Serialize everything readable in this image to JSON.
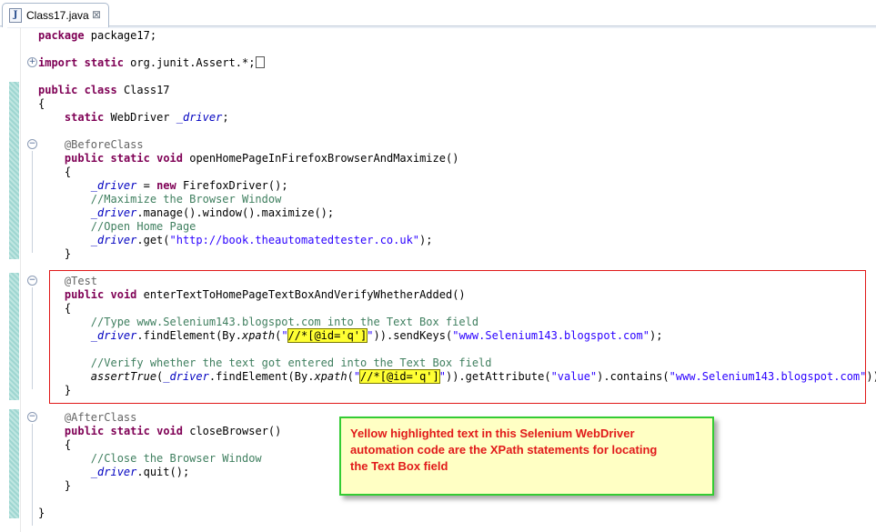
{
  "tab": {
    "icon": "java-file-icon",
    "title": "Class17.java",
    "close": "⊠"
  },
  "fold_markers": {
    "expand": "+",
    "collapse": "−"
  },
  "code": [
    [
      [
        "kw",
        "package"
      ],
      [
        "t",
        " package17;"
      ]
    ],
    [],
    [
      [
        "kw",
        "import"
      ],
      [
        "t",
        " "
      ],
      [
        "kw",
        "static"
      ],
      [
        "t",
        " org.junit.Assert.*;"
      ],
      [
        "box",
        ""
      ]
    ],
    [],
    [
      [
        "kw",
        "public"
      ],
      [
        "t",
        " "
      ],
      [
        "kw",
        "class"
      ],
      [
        "t",
        " Class17"
      ]
    ],
    [
      [
        "t",
        "{"
      ]
    ],
    [
      [
        "t",
        "    "
      ],
      [
        "kw",
        "static"
      ],
      [
        "t",
        " WebDriver "
      ],
      [
        "fld",
        "_driver"
      ],
      [
        "t",
        ";"
      ]
    ],
    [],
    [
      [
        "t",
        "    "
      ],
      [
        "ann",
        "@BeforeClass"
      ]
    ],
    [
      [
        "t",
        "    "
      ],
      [
        "kw",
        "public"
      ],
      [
        "t",
        " "
      ],
      [
        "kw",
        "static"
      ],
      [
        "t",
        " "
      ],
      [
        "kw",
        "void"
      ],
      [
        "t",
        " openHomePageInFirefoxBrowserAndMaximize()"
      ]
    ],
    [
      [
        "t",
        "    {"
      ]
    ],
    [
      [
        "t",
        "        "
      ],
      [
        "fld",
        "_driver"
      ],
      [
        "t",
        " = "
      ],
      [
        "kw",
        "new"
      ],
      [
        "t",
        " FirefoxDriver();"
      ]
    ],
    [
      [
        "t",
        "        "
      ],
      [
        "cmt",
        "//Maximize the Browser Window"
      ]
    ],
    [
      [
        "t",
        "        "
      ],
      [
        "fld",
        "_driver"
      ],
      [
        "t",
        ".manage().window().maximize();"
      ]
    ],
    [
      [
        "t",
        "        "
      ],
      [
        "cmt",
        "//Open Home Page"
      ]
    ],
    [
      [
        "t",
        "        "
      ],
      [
        "fld",
        "_driver"
      ],
      [
        "t",
        ".get("
      ],
      [
        "str",
        "\"http://book.theautomatedtester.co.uk\""
      ],
      [
        "t",
        ");"
      ]
    ],
    [
      [
        "t",
        "    }"
      ]
    ],
    [],
    [
      [
        "t",
        "    "
      ],
      [
        "ann",
        "@Test"
      ]
    ],
    [
      [
        "t",
        "    "
      ],
      [
        "kw",
        "public"
      ],
      [
        "t",
        " "
      ],
      [
        "kw",
        "void"
      ],
      [
        "t",
        " enterTextToHomePageTextBoxAndVerifyWhetherAdded()"
      ]
    ],
    [
      [
        "t",
        "    {"
      ]
    ],
    [
      [
        "t",
        "        "
      ],
      [
        "cmt",
        "//Type www.Selenium143.blogspot.com into the Text Box field"
      ]
    ],
    [
      [
        "t",
        "        "
      ],
      [
        "fld",
        "_driver"
      ],
      [
        "t",
        ".findElement(By."
      ],
      [
        "it",
        "xpath"
      ],
      [
        "t",
        "("
      ],
      [
        "str",
        "\""
      ],
      [
        "hl",
        "//*[@id='q']"
      ],
      [
        "str",
        "\""
      ],
      [
        "t",
        "))."
      ],
      [
        "t",
        "sendKeys("
      ],
      [
        "str",
        "\"www.Selenium143.blogspot.com\""
      ],
      [
        "t",
        ");"
      ]
    ],
    [],
    [
      [
        "t",
        "        "
      ],
      [
        "cmt",
        "//Verify whether the text got entered into the Text Box field"
      ]
    ],
    [
      [
        "t",
        "        "
      ],
      [
        "it",
        "assertTrue"
      ],
      [
        "t",
        "("
      ],
      [
        "fld",
        "_driver"
      ],
      [
        "t",
        ".findElement(By."
      ],
      [
        "it",
        "xpath"
      ],
      [
        "t",
        "("
      ],
      [
        "str",
        "\""
      ],
      [
        "hl",
        "//*[@id='q']"
      ],
      [
        "str",
        "\""
      ],
      [
        "t",
        ")).getAttribute("
      ],
      [
        "str",
        "\"value\""
      ],
      [
        "t",
        ").contains("
      ],
      [
        "str",
        "\"www.Selenium143.blogspot.com\""
      ],
      [
        "t",
        "));"
      ]
    ],
    [
      [
        "t",
        "    }"
      ]
    ],
    [],
    [
      [
        "t",
        "    "
      ],
      [
        "ann",
        "@AfterClass"
      ]
    ],
    [
      [
        "t",
        "    "
      ],
      [
        "kw",
        "public"
      ],
      [
        "t",
        " "
      ],
      [
        "kw",
        "static"
      ],
      [
        "t",
        " "
      ],
      [
        "kw",
        "void"
      ],
      [
        "t",
        " closeBrowser()"
      ]
    ],
    [
      [
        "t",
        "    {"
      ]
    ],
    [
      [
        "t",
        "        "
      ],
      [
        "cmt",
        "//Close the Browser Window"
      ]
    ],
    [
      [
        "t",
        "        "
      ],
      [
        "fld",
        "_driver"
      ],
      [
        "t",
        ".quit();"
      ]
    ],
    [
      [
        "t",
        "    }"
      ]
    ],
    [],
    [
      [
        "t",
        "}"
      ]
    ]
  ],
  "callout": {
    "text": "Yellow highlighted text in this Selenium WebDriver\nautomation code are the XPath statements for locating\nthe Text Box field"
  },
  "colors": {
    "keyword": "#7f0055",
    "field": "#0000c0",
    "string": "#2a00ff",
    "comment": "#3f7f5f",
    "annotation": "#646464",
    "highlight": "#ffff33",
    "red_box": "#e01818",
    "callout_border": "#33cc33",
    "callout_fill": "#ffffc4",
    "callout_text": "#e11a1a"
  }
}
